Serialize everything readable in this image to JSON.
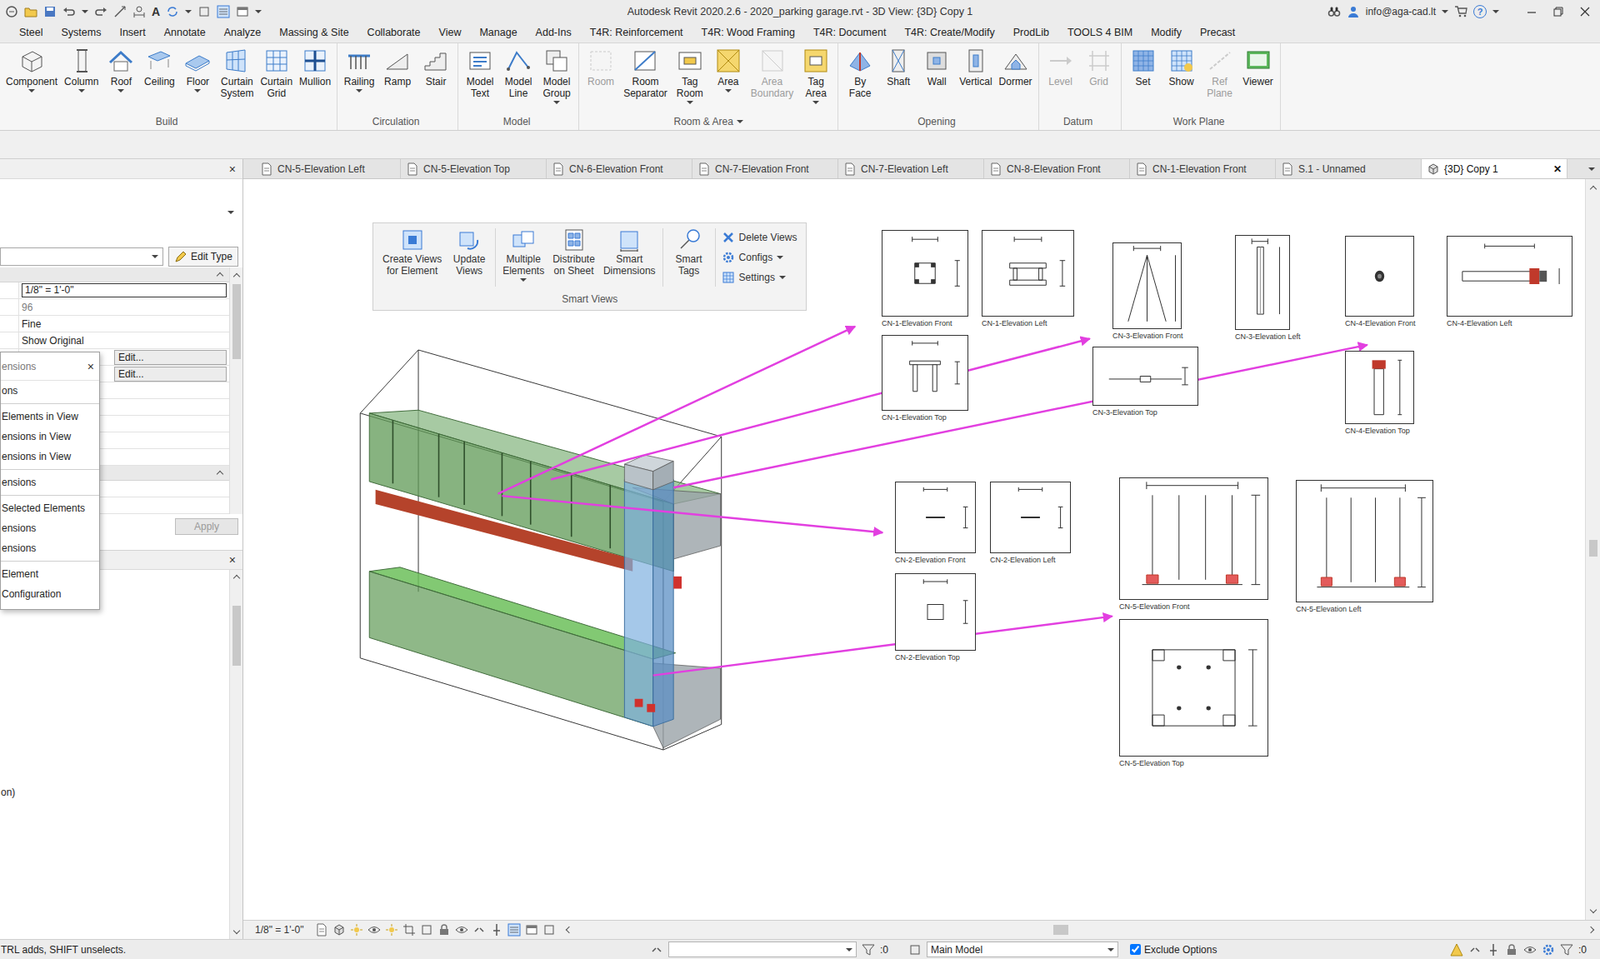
{
  "window": {
    "title": "Autodesk Revit 2020.2.6 - 2020_parking garage.rvt - 3D View: {3D} Copy 1",
    "text_tool": "A",
    "user": "info@aga-cad.lt",
    "help": "?"
  },
  "menu_tabs": [
    "Steel",
    "Systems",
    "Insert",
    "Annotate",
    "Analyze",
    "Massing & Site",
    "Collaborate",
    "View",
    "Manage",
    "Add-Ins",
    "T4R: Reinforcement",
    "T4R: Wood Framing",
    "T4R: Document",
    "T4R: Create/Modify",
    "ProdLib",
    "TOOLS 4 BIM",
    "Modify",
    "Precast"
  ],
  "ribbon": {
    "groups": [
      {
        "label": "Build",
        "dropdown": false,
        "buttons": [
          {
            "label": "Component",
            "dropdown": true,
            "disabled": false
          },
          {
            "label": "Column",
            "dropdown": true,
            "disabled": false
          },
          {
            "label": "Roof",
            "dropdown": true,
            "disabled": false
          },
          {
            "label": "Ceiling",
            "dropdown": false,
            "disabled": false
          },
          {
            "label": "Floor",
            "dropdown": true,
            "disabled": false
          },
          {
            "label": "Curtain\nSystem",
            "dropdown": false,
            "disabled": false
          },
          {
            "label": "Curtain\nGrid",
            "dropdown": false,
            "disabled": false
          },
          {
            "label": "Mullion",
            "dropdown": false,
            "disabled": false
          }
        ]
      },
      {
        "label": "Circulation",
        "dropdown": false,
        "buttons": [
          {
            "label": "Railing",
            "dropdown": true,
            "disabled": false
          },
          {
            "label": "Ramp",
            "dropdown": false,
            "disabled": false
          },
          {
            "label": "Stair",
            "dropdown": false,
            "disabled": false
          }
        ]
      },
      {
        "label": "Model",
        "dropdown": false,
        "buttons": [
          {
            "label": "Model\nText",
            "dropdown": false,
            "disabled": false
          },
          {
            "label": "Model\nLine",
            "dropdown": false,
            "disabled": false
          },
          {
            "label": "Model\nGroup",
            "dropdown": true,
            "disabled": false
          }
        ]
      },
      {
        "label": "Room & Area",
        "dropdown": true,
        "buttons": [
          {
            "label": "Room",
            "dropdown": false,
            "disabled": true
          },
          {
            "label": "Room\nSeparator",
            "dropdown": false,
            "disabled": false
          },
          {
            "label": "Tag\nRoom",
            "dropdown": true,
            "disabled": false
          },
          {
            "label": "Area",
            "dropdown": true,
            "disabled": false
          },
          {
            "label": "Area\nBoundary",
            "dropdown": false,
            "disabled": true
          },
          {
            "label": "Tag\nArea",
            "dropdown": true,
            "disabled": false
          }
        ]
      },
      {
        "label": "Opening",
        "dropdown": false,
        "buttons": [
          {
            "label": "By\nFace",
            "dropdown": false,
            "disabled": false
          },
          {
            "label": "Shaft",
            "dropdown": false,
            "disabled": false
          },
          {
            "label": "Wall",
            "dropdown": false,
            "disabled": false
          },
          {
            "label": "Vertical",
            "dropdown": false,
            "disabled": false
          },
          {
            "label": "Dormer",
            "dropdown": false,
            "disabled": false
          }
        ]
      },
      {
        "label": "Datum",
        "dropdown": false,
        "buttons": [
          {
            "label": "Level",
            "dropdown": false,
            "disabled": true
          },
          {
            "label": "Grid",
            "dropdown": false,
            "disabled": true
          }
        ]
      },
      {
        "label": "Work Plane",
        "dropdown": false,
        "buttons": [
          {
            "label": "Set",
            "dropdown": false,
            "disabled": false
          },
          {
            "label": "Show",
            "dropdown": false,
            "disabled": false
          },
          {
            "label": "Ref\nPlane",
            "dropdown": false,
            "disabled": true
          },
          {
            "label": "Viewer",
            "dropdown": false,
            "disabled": false
          }
        ]
      }
    ]
  },
  "view_tabs": {
    "close": "✕",
    "items": [
      {
        "label": "CN-5-Elevation Left",
        "selected": false
      },
      {
        "label": "CN-5-Elevation Top",
        "selected": false
      },
      {
        "label": "CN-6-Elevation Front",
        "selected": false
      },
      {
        "label": "CN-7-Elevation Front",
        "selected": false
      },
      {
        "label": "CN-7-Elevation Left",
        "selected": false
      },
      {
        "label": "CN-8-Elevation Front",
        "selected": false
      },
      {
        "label": "CN-1-Elevation Front",
        "selected": false
      },
      {
        "label": "S.1 - Unnamed",
        "selected": false
      },
      {
        "label": "{3D} Copy 1",
        "selected": true
      }
    ]
  },
  "properties": {
    "close": "×",
    "edit_type": "Edit Type",
    "rows": [
      {
        "kind": "field",
        "value": "1/8\" = 1'-0\""
      },
      {
        "kind": "greyed",
        "value": "96"
      },
      {
        "kind": "text",
        "value": "Fine"
      },
      {
        "kind": "text",
        "value": "Show Original"
      },
      {
        "kind": "button",
        "value": "Edit..."
      },
      {
        "kind": "button",
        "value": "Edit..."
      }
    ],
    "apply": {
      "label": "Apply",
      "disabled": true
    }
  },
  "popup_menu": {
    "title": "ensions",
    "close": "×",
    "groups": [
      [
        "ons"
      ],
      [
        "Elements in View",
        "ensions in View",
        "ensions in View"
      ],
      [
        "ensions"
      ],
      [
        "Selected Elements",
        "ensions",
        "ensions"
      ],
      [
        "Element",
        "Configuration"
      ]
    ]
  },
  "browser": {
    "close": "×",
    "text": "on)"
  },
  "smart_views": {
    "title": "Smart Views",
    "buttons": [
      {
        "label": "Create Views\nfor Element",
        "dropdown": false
      },
      {
        "label": "Update\nViews",
        "dropdown": false
      },
      {
        "label": "Multiple\nElements",
        "dropdown": true
      },
      {
        "label": "Distribute\non Sheet",
        "dropdown": false
      },
      {
        "label": "Smart\nDimensions",
        "dropdown": false
      },
      {
        "label": "Smart\nTags",
        "dropdown": false
      }
    ],
    "side": [
      {
        "label": "Delete Views",
        "dropdown": false
      },
      {
        "label": "Configs",
        "dropdown": true
      },
      {
        "label": "Settings",
        "dropdown": true
      }
    ]
  },
  "views": [
    {
      "label": "CN-1-Elevation Front",
      "kind": "square"
    },
    {
      "label": "CN-1-Elevation Left",
      "kind": "frame"
    },
    {
      "label": "CN-1-Elevation Top",
      "kind": "frametop"
    },
    {
      "label": "CN-3-Elevation Front",
      "kind": "tripod"
    },
    {
      "label": "CN-3-Elevation Left",
      "kind": "post"
    },
    {
      "label": "CN-3-Elevation Top",
      "kind": "cross"
    },
    {
      "label": "CN-4-Elevation Front",
      "kind": "dot"
    },
    {
      "label": "CN-4-Elevation Left",
      "kind": "rod"
    },
    {
      "label": "CN-4-Elevation Top",
      "kind": "rodv"
    },
    {
      "label": "CN-2-Elevation Front",
      "kind": "dash"
    },
    {
      "label": "CN-2-Elevation Left",
      "kind": "dash"
    },
    {
      "label": "CN-2-Elevation Top",
      "kind": "box"
    },
    {
      "label": "CN-5-Elevation Front",
      "kind": "rods"
    },
    {
      "label": "CN-5-Elevation Left",
      "kind": "rods"
    },
    {
      "label": "CN-5-Elevation Top",
      "kind": "plate"
    }
  ],
  "view_control": {
    "scale": "1/8\" = 1'-0\""
  },
  "status_bar": {
    "hint": "TRL adds, SHIFT unselects.",
    "selection": ":0",
    "model": "Main Model",
    "exclude_options": {
      "label": "Exclude Options",
      "checked": true
    },
    "filter": ":0"
  }
}
